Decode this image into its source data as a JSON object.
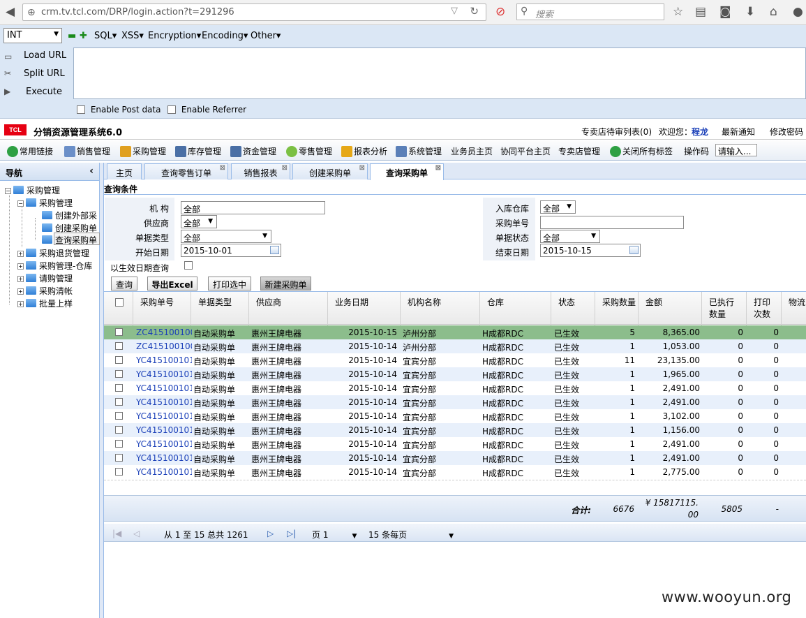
{
  "browser": {
    "url": "crm.tv.tcl.com/DRP/login.action?t=291296",
    "search_placeholder": "搜索"
  },
  "hackbar": {
    "select_value": "INT",
    "menus": [
      "SQL",
      "XSS",
      "Encryption",
      "Encoding",
      "Other"
    ],
    "side": [
      "Load URL",
      "Split URL",
      "Execute"
    ],
    "enable_post": "Enable Post data",
    "enable_referrer": "Enable Referrer"
  },
  "app": {
    "logo": "TCL",
    "title": "分销资源管理系统6.0",
    "header_links": [
      "专卖店待审列表(0)",
      "欢迎您：",
      "程龙",
      "最新通知",
      "修改密码"
    ],
    "menu": [
      "常用链接",
      "销售管理",
      "采购管理",
      "库存管理",
      "资金管理",
      "零售管理",
      "报表分析",
      "系统管理",
      "业务员主页",
      "协同平台主页",
      "专卖店管理",
      "关闭所有标签",
      "操作码"
    ],
    "op_placeholder": "请输入..."
  },
  "sidebar": {
    "title": "导航",
    "root": "采购管理",
    "sub": "采购管理",
    "leaves": [
      "创建外部采",
      "创建采购单",
      "查询采购单"
    ],
    "siblings": [
      "采购退货管理",
      "采购管理-仓库",
      "请购管理",
      "采购清帐",
      "批量上样"
    ]
  },
  "tabs": [
    "主页",
    "查询零售订单",
    "销售报表",
    "创建采购单",
    "查询采购单"
  ],
  "query": {
    "title": "查询条件",
    "labels_left": [
      "机 构",
      "供应商",
      "单据类型",
      "开始日期",
      "以生效日期查询"
    ],
    "values_left": [
      "全部",
      "全部",
      "全部",
      "2015-10-01"
    ],
    "labels_right": [
      "入库仓库",
      "采购单号",
      "单据状态",
      "结束日期"
    ],
    "values_right": [
      "全部",
      "",
      "全部",
      "2015-10-15"
    ],
    "buttons": [
      "查询",
      "导出Excel",
      "打印选中",
      "新建采购单"
    ]
  },
  "grid": {
    "columns": [
      "采购单号",
      "单据类型",
      "供应商",
      "业务日期",
      "机构名称",
      "仓库",
      "状态",
      "采购数量",
      "金额",
      "已执行数量",
      "打印次数",
      "物流"
    ],
    "rows": [
      [
        "ZC415100100(",
        "自动采购单",
        "惠州王牌电器",
        "2015-10-15",
        "泸州分部",
        "H成都RDC",
        "已生效",
        "5",
        "8,365.00",
        "0",
        "0"
      ],
      [
        "ZC415100100(",
        "自动采购单",
        "惠州王牌电器",
        "2015-10-14",
        "泸州分部",
        "H成都RDC",
        "已生效",
        "1",
        "1,053.00",
        "0",
        "0"
      ],
      [
        "YC41510010117",
        "自动采购单",
        "惠州王牌电器",
        "2015-10-14",
        "宜宾分部",
        "H成都RDC",
        "已生效",
        "11",
        "23,135.00",
        "0",
        "0"
      ],
      [
        "YC415100101(",
        "自动采购单",
        "惠州王牌电器",
        "2015-10-14",
        "宜宾分部",
        "H成都RDC",
        "已生效",
        "1",
        "1,965.00",
        "0",
        "0"
      ],
      [
        "YC415100101(",
        "自动采购单",
        "惠州王牌电器",
        "2015-10-14",
        "宜宾分部",
        "H成都RDC",
        "已生效",
        "1",
        "2,491.00",
        "0",
        "0"
      ],
      [
        "YC415100101(",
        "自动采购单",
        "惠州王牌电器",
        "2015-10-14",
        "宜宾分部",
        "H成都RDC",
        "已生效",
        "1",
        "2,491.00",
        "0",
        "0"
      ],
      [
        "YC415100101(",
        "自动采购单",
        "惠州王牌电器",
        "2015-10-14",
        "宜宾分部",
        "H成都RDC",
        "已生效",
        "1",
        "3,102.00",
        "0",
        "0"
      ],
      [
        "YC415100101(",
        "自动采购单",
        "惠州王牌电器",
        "2015-10-14",
        "宜宾分部",
        "H成都RDC",
        "已生效",
        "1",
        "1,156.00",
        "0",
        "0"
      ],
      [
        "YC415100101(",
        "自动采购单",
        "惠州王牌电器",
        "2015-10-14",
        "宜宾分部",
        "H成都RDC",
        "已生效",
        "1",
        "2,491.00",
        "0",
        "0"
      ],
      [
        "YC415100101(",
        "自动采购单",
        "惠州王牌电器",
        "2015-10-14",
        "宜宾分部",
        "H成都RDC",
        "已生效",
        "1",
        "2,491.00",
        "0",
        "0"
      ],
      [
        "YC415100101(",
        "自动采购单",
        "惠州王牌电器",
        "2015-10-14",
        "宜宾分部",
        "H成都RDC",
        "已生效",
        "1",
        "2,775.00",
        "0",
        "0"
      ]
    ],
    "summary_label": "合计:",
    "summary_qty": "6676",
    "summary_amount_1": "¥ 15817115.",
    "summary_amount_2": "00",
    "summary_executed": "5805",
    "summary_print": "-"
  },
  "pager": {
    "info": "从 1 至 15 总共 1261",
    "page": "页 1",
    "per_page": "15 条每页"
  },
  "watermark": "www.wooyun.org"
}
